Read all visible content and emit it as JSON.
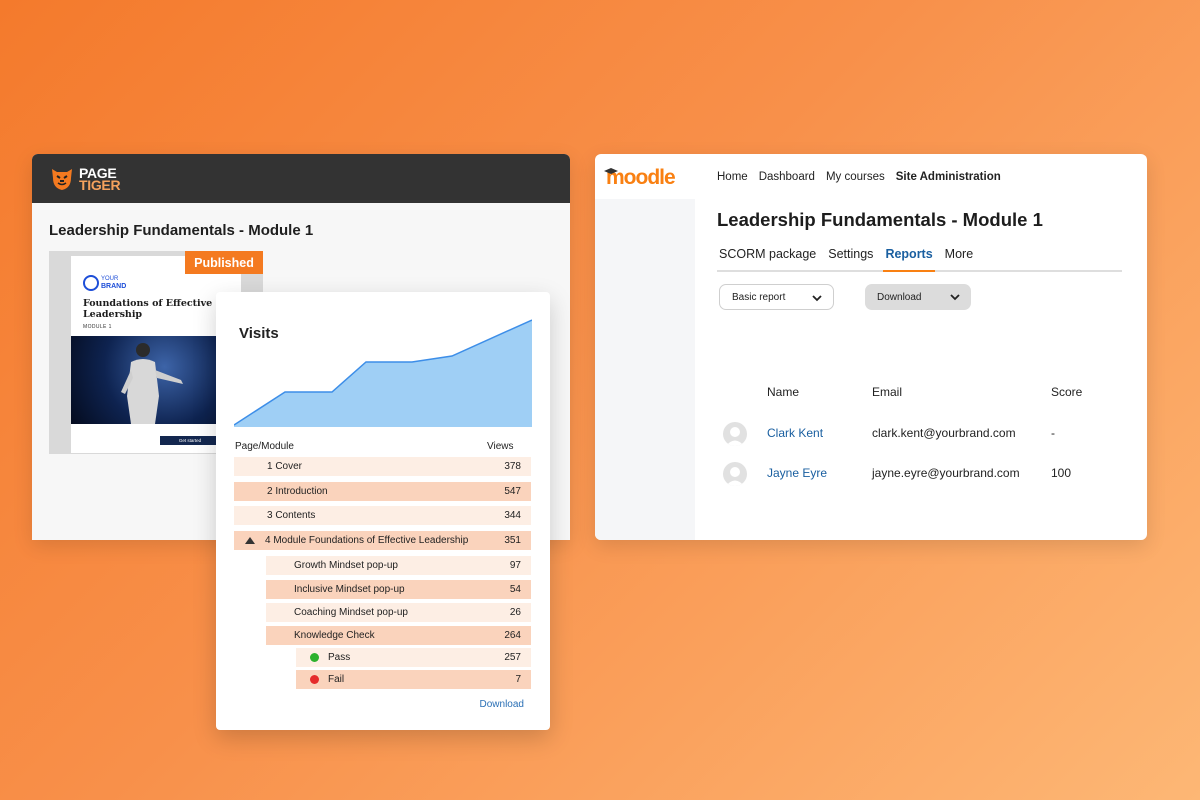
{
  "pagetiger": {
    "logo_line1": "PAGE",
    "logo_line2": "TIGER",
    "title": "Leadership Fundamentals - Module 1",
    "status_badge": "Published",
    "preview": {
      "brand_small": "YOUR",
      "brand_large": "BRAND",
      "heading": "Foundations of Effective Leadership",
      "subheading": "MODULE 1",
      "cta": "Get started"
    }
  },
  "analytics": {
    "title": "Visits",
    "col_page": "Page/Module",
    "col_views": "Views",
    "rows": [
      {
        "label": "1 Cover",
        "views": "378"
      },
      {
        "label": "2 Introduction",
        "views": "547"
      },
      {
        "label": "3 Contents",
        "views": "344"
      },
      {
        "label": "4 Module Foundations of Effective Leadership",
        "views": "351"
      },
      {
        "label": "Growth Mindset pop-up",
        "views": "97"
      },
      {
        "label": "Inclusive Mindset pop-up",
        "views": "54"
      },
      {
        "label": "Coaching Mindset pop-up",
        "views": "26"
      },
      {
        "label": "Knowledge Check",
        "views": "264"
      },
      {
        "label": "Pass",
        "views": "257"
      },
      {
        "label": "Fail",
        "views": "7"
      }
    ],
    "download_label": "Download",
    "colors": {
      "chart_fill": "#9fcff5",
      "chart_line": "#3d8ee8",
      "pass": "#2db12d",
      "fail": "#e52b2b"
    }
  },
  "moodle": {
    "logo": "moodle",
    "nav": [
      "Home",
      "Dashboard",
      "My courses",
      "Site Administration"
    ],
    "title": "Leadership Fundamentals - Module 1",
    "tabs": [
      "SCORM package",
      "Settings",
      "Reports",
      "More"
    ],
    "report_select": "Basic report",
    "download_select": "Download",
    "headers": {
      "name": "Name",
      "email": "Email",
      "score": "Score"
    },
    "users": [
      {
        "name": "Clark Kent",
        "email": "clark.kent@yourbrand.com",
        "score": "-"
      },
      {
        "name": "Jayne Eyre",
        "email": "jayne.eyre@yourbrand.com",
        "score": "100"
      }
    ],
    "colors": {
      "accent": "#f98012",
      "link": "#1a5fa0"
    }
  }
}
